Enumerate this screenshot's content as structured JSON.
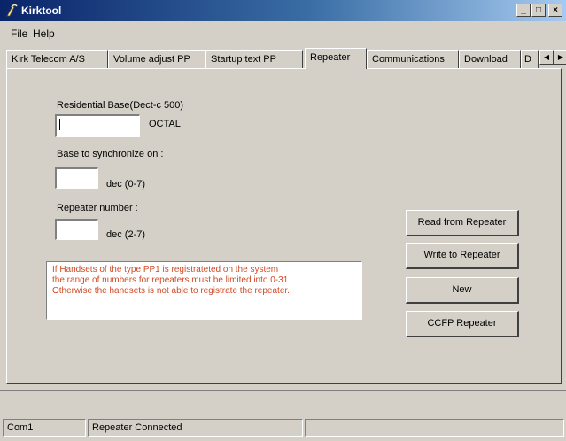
{
  "window": {
    "title": "Kirktool",
    "titlebar_colors": [
      "#0a246a",
      "#a6caf0"
    ]
  },
  "menu": {
    "file": "File",
    "help": "Help"
  },
  "tabs": {
    "items": [
      {
        "label": "Kirk Telecom A/S"
      },
      {
        "label": "Volume adjust PP"
      },
      {
        "label": "Startup text PP"
      },
      {
        "label": "Repeater"
      },
      {
        "label": "Communications"
      },
      {
        "label": "Download"
      },
      {
        "label": "D"
      }
    ],
    "active": "Repeater"
  },
  "repeater": {
    "residential_label": "Residential Base(Dect-c 500)",
    "residential_value": "",
    "residential_unit": "OCTAL",
    "sync_label": "Base to synchronize on :",
    "sync_value": "",
    "sync_unit": "dec (0-7)",
    "number_label": "Repeater number :",
    "number_value": "",
    "number_unit": "dec (2-7)",
    "message_lines": [
      "If Handsets of the type PP1 is registrateted on the system",
      "the range of numbers for repeaters must be limited into 0-31",
      "Otherwise the handsets is not able to registrate the repeater."
    ],
    "message_color": "#d04a24",
    "buttons": {
      "read": "Read from Repeater",
      "write": "Write to Repeater",
      "new": "New",
      "ccfp": "CCFP Repeater"
    }
  },
  "status": {
    "left": "Com1",
    "middle": "Repeater Connected",
    "right": ""
  }
}
